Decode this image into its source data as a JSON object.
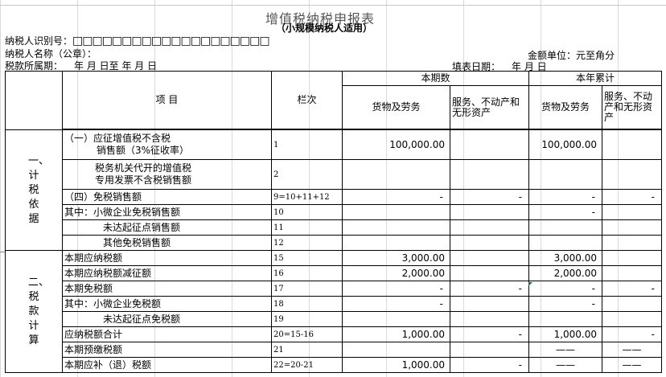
{
  "form": {
    "title": "增值税纳税申报表",
    "subtitle": "（小规模纳税人适用）",
    "taxpayer_id_label": "纳税人识别号：",
    "taxpayer_id_boxes": "□□□□□□□□□□□□□□□□□□□□",
    "taxpayer_name_label": "纳税人名称（公章）：",
    "amount_unit": "金额单位：元至角分",
    "period_label": "税款所属期：",
    "period_value": "年  月  日至   年  月  日",
    "fill_date_label": "填表日期：",
    "fill_date_value": "年  月  日"
  },
  "headers": {
    "item": "项 目",
    "col_no": "栏次",
    "current_period": "本期数",
    "year_total": "本年累计",
    "goods": "货物及劳务",
    "services": "服务、不动产和无形资产",
    "services_year": "服务、不动产和无形资产"
  },
  "sections": {
    "basis": "一、计税依据",
    "calc": "二、税款计算"
  },
  "rows": [
    {
      "item_line1": "（一）应征增值税不含税",
      "item_line2": "销售额（3%征收率）",
      "col": "1",
      "goods": "100,000.00",
      "services": "",
      "goods_year": "100,000.00",
      "services_year": ""
    },
    {
      "item_line1": "税务机关代开的增值税",
      "item_line2": "专用发票不含税销售额",
      "col": "2",
      "goods": "",
      "services": "",
      "goods_year": "",
      "services_year": ""
    },
    {
      "item": "（四）免税销售额",
      "col": "9=10+11+12",
      "goods": "-",
      "services": "-",
      "goods_year": "-",
      "services_year": "-"
    },
    {
      "item": "其中：小微企业免税销售额",
      "col": "10",
      "goods": "",
      "services": "",
      "goods_year": "-",
      "services_year": ""
    },
    {
      "item": "未达起征点销售额",
      "col": "11",
      "goods": "",
      "services": "",
      "goods_year": "",
      "services_year": ""
    },
    {
      "item": "其他免税销售额",
      "col": "12",
      "goods": "",
      "services": "",
      "goods_year": "",
      "services_year": ""
    },
    {
      "item": "本期应纳税额",
      "col": "15",
      "goods": "3,000.00",
      "services": "",
      "goods_year": "3,000.00",
      "services_year": ""
    },
    {
      "item": "本期应纳税额减征额",
      "col": "16",
      "goods": "2,000.00",
      "services": "",
      "goods_year": "2,000.00",
      "services_year": ""
    },
    {
      "item": "本期免税额",
      "col": "17",
      "goods": "-",
      "services": "-",
      "goods_year": "-",
      "services_year": "-"
    },
    {
      "item": "其中：小微企业免税额",
      "col": "18",
      "goods": "-",
      "services": "",
      "goods_year": "-",
      "services_year": ""
    },
    {
      "item": "未达起征点免税额",
      "col": "19",
      "goods": "",
      "services": "",
      "goods_year": "",
      "services_year": ""
    },
    {
      "item": "应纳税额合计",
      "col": "20=15-16",
      "goods": "1,000.00",
      "services": "-",
      "goods_year": "1,000.00",
      "services_year": "-"
    },
    {
      "item": "本期预缴税额",
      "col": "21",
      "goods": "",
      "services": "",
      "goods_year": "——",
      "services_year": "——"
    },
    {
      "item": "本期应补（退）税额",
      "col": "22=20-21",
      "goods": "1,000.00",
      "services": "-",
      "goods_year": "——",
      "services_year": "——"
    }
  ]
}
